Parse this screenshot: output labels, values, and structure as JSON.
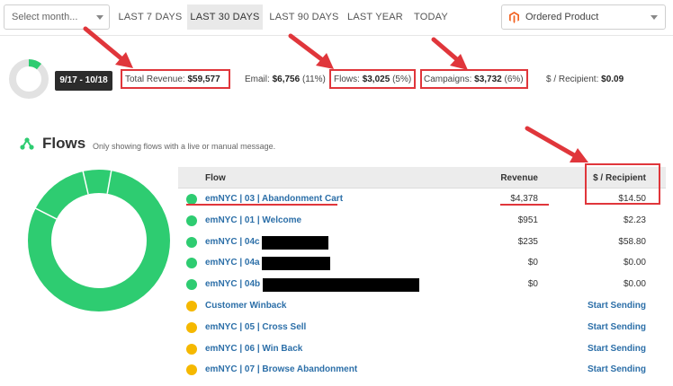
{
  "toolbar": {
    "month_placeholder": "Select month...",
    "ranges": [
      "LAST 7 DAYS",
      "LAST 30 DAYS",
      "LAST 90 DAYS",
      "LAST YEAR",
      "TODAY"
    ],
    "active_range": "LAST 30 DAYS",
    "metric": "Ordered Product"
  },
  "summary": {
    "date_range": "9/17 - 10/18",
    "total_revenue_label": "Total Revenue:",
    "total_revenue_value": "$59,577",
    "email_label": "Email:",
    "email_value": "$6,756",
    "email_pct": "(11%)",
    "flows_label": "Flows:",
    "flows_value": "$3,025",
    "flows_pct": "(5%)",
    "campaigns_label": "Campaigns:",
    "campaigns_value": "$3,732",
    "campaigns_pct": "(6%)",
    "per_recipient_label": "$ / Recipient:",
    "per_recipient_value": "$0.09",
    "donut_fill_fraction": 0.11
  },
  "flows": {
    "title": "Flows",
    "note": "Only showing flows with a live or manual message.",
    "columns": {
      "flow": "Flow",
      "revenue": "Revenue",
      "per_recipient": "$ / Recipient"
    },
    "rows": [
      {
        "name": "emNYC | 03 | Abandonment Cart",
        "revenue": "$4,378",
        "per_recipient": "$14.50",
        "status": "live"
      },
      {
        "name": "emNYC | 01 | Welcome",
        "revenue": "$951",
        "per_recipient": "$2.23",
        "status": "live"
      },
      {
        "name": "emNYC | 04c |",
        "revenue": "$235",
        "per_recipient": "$58.80",
        "status": "live"
      },
      {
        "name": "emNYC | 04a |",
        "revenue": "$0",
        "per_recipient": "$0.00",
        "status": "live"
      },
      {
        "name": "emNYC | 04b |",
        "revenue": "$0",
        "per_recipient": "$0.00",
        "status": "live"
      },
      {
        "name": "Customer Winback",
        "revenue": "",
        "per_recipient": "Start Sending",
        "status": "manual"
      },
      {
        "name": "emNYC | 05 | Cross Sell",
        "revenue": "",
        "per_recipient": "Start Sending",
        "status": "manual"
      },
      {
        "name": "emNYC | 06 | Win Back",
        "revenue": "",
        "per_recipient": "Start Sending",
        "status": "manual"
      },
      {
        "name": "emNYC | 07 | Browse Abandonment",
        "revenue": "",
        "per_recipient": "Start Sending",
        "status": "manual"
      }
    ]
  },
  "colors": {
    "live": "#2ecc71",
    "manual": "#f5b800",
    "annotation": "#e0363b",
    "link": "#2c6fa8"
  }
}
